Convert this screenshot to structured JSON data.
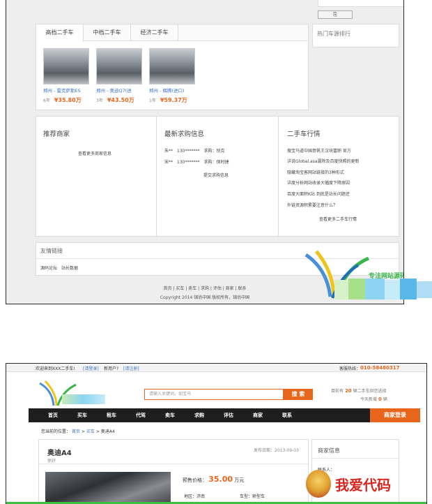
{
  "shot1": {
    "small_button": "⎘",
    "tabs": [
      "高档二手车",
      "中档二手车",
      "经济二手车"
    ],
    "hot_ranking_title": "热门车源排行",
    "cars": [
      {
        "name": "郑州 - 雷克萨斯ES",
        "year": "6年",
        "price": "¥35.80万"
      },
      {
        "name": "郑州 - 奥迪Q7(进",
        "year": "3年",
        "price": "¥43.50万"
      },
      {
        "name": "郑州 - 辉腾(进口)",
        "year": "1年",
        "price": "¥59.37万"
      }
    ],
    "recommend": {
      "title": "推荐商家",
      "more": "查看更多商家信息"
    },
    "wanted": {
      "title": "最新求购信息",
      "items": [
        "朱**　130*******　求购：别克",
        "宋**　130*******　求购：保时捷"
      ],
      "submit": "提交求购信息"
    },
    "market": {
      "title": "二手车行情",
      "items": [
        "搜宝马道中国意帆王汉块富职 官方",
        "详说Global.asa漏除及百度快照的更新",
        "隐藏淘宝客网站链接的3种形式",
        "详度分析网站收录大幅度下降原因",
        "百度大面积K站 到底是站长问题还",
        "外链资源积累要注意什么？"
      ],
      "more": "查看更多二手车行情"
    },
    "links": {
      "title": "友情链接",
      "items": [
        "源码论坛",
        "站长数据"
      ]
    },
    "footer": {
      "nav": "首页 | 买车 | 卖车 | 求购 | 评估 | 商家 | 联系",
      "copyright": "Copyright 2014 锦尚中国 版权所有，锦尚中国"
    },
    "watermark": "专注网站源码"
  },
  "shot2": {
    "topbar": {
      "welcome": "欢迎来到XXX二手车!",
      "login": "[请登录]",
      "new_user": "新用户?",
      "register": "[请注册]",
      "hotline_label": "客服热线：",
      "hotline": "010-58480317"
    },
    "search_placeholder": "请输入关键词，如宝马",
    "search_btn": "搜 索",
    "stats": {
      "line1_pre": "目前有",
      "count1": "20",
      "line1_post": "辆二手车供您选择",
      "line2_pre": "今天新增",
      "count2": "0",
      "line2_post": "辆"
    },
    "nav": [
      "首页",
      "买车",
      "租车",
      "代驾",
      "卖车",
      "求购",
      "评估",
      "商家",
      "联系"
    ],
    "dealer_login": "商家登录",
    "breadcrumb": {
      "label": "您当前的位置：",
      "home": "首页",
      "sep1": ">",
      "buy": "买车",
      "sep2": ">",
      "current": "奥迪A4"
    },
    "car_title": "奥迪A4",
    "car_sub": "徐好",
    "publish_date": "发布日期：2013-09-03",
    "dealer_info_title": "商家信息",
    "contact_label": "联系人：",
    "price_label": "预售价格：",
    "price_value": "35.00",
    "price_unit": "万元",
    "region_label": "地区：济南",
    "model_label": "车型：轿型车",
    "watermark": "我爱代码"
  }
}
